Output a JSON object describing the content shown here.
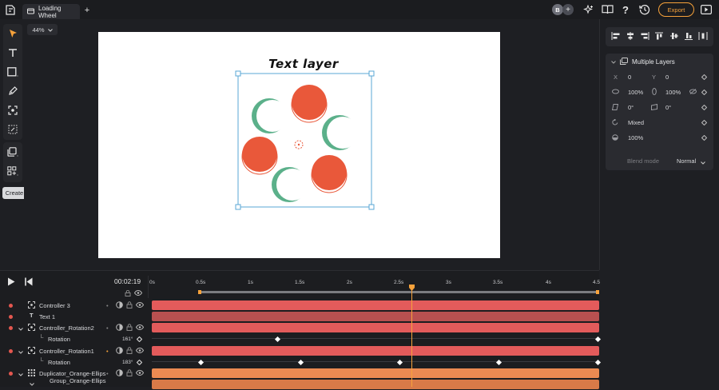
{
  "tab": {
    "title": "Loading Wheel"
  },
  "header": {
    "avatar_letter": "B",
    "export_label": "Export"
  },
  "canvas": {
    "zoom": "44%",
    "text_layer": "Text layer"
  },
  "tooltip": {
    "create_scene": "Create scene"
  },
  "panel": {
    "title": "Multiple Layers",
    "x_label": "X",
    "x_value": "0",
    "y_label": "Y",
    "y_value": "0",
    "scale_w": "100%",
    "scale_h": "100%",
    "skew_a": "0°",
    "skew_b": "0°",
    "rotation": "Mixed",
    "opacity": "100%",
    "blend_label": "Blend mode",
    "blend_value": "Normal"
  },
  "timeline": {
    "time": "00:02:19",
    "ticks": [
      "0s",
      "0.5s",
      "1s",
      "1.5s",
      "2s",
      "2.5s",
      "3s",
      "3.5s",
      "4s",
      "4.5"
    ],
    "layers": [
      {
        "name": "Controller 3",
        "value": ""
      },
      {
        "name": "Text 1",
        "value": ""
      },
      {
        "name": "Controller_Rotation2",
        "value": ""
      },
      {
        "name": "Rotation",
        "value": "161°"
      },
      {
        "name": "Controller_Rotation1",
        "value": ""
      },
      {
        "name": "Rotation",
        "value": "183°"
      },
      {
        "name": "Duplicator_Orange-Ellips",
        "value": ""
      },
      {
        "name": "Group_Orange-Ellips",
        "value": ""
      }
    ]
  },
  "colors": {
    "orange": "#e9583a",
    "green": "#5bb08a",
    "accent": "#f7a23b",
    "track_red": "#e35b5b",
    "track_orange": "#eb8a52"
  }
}
